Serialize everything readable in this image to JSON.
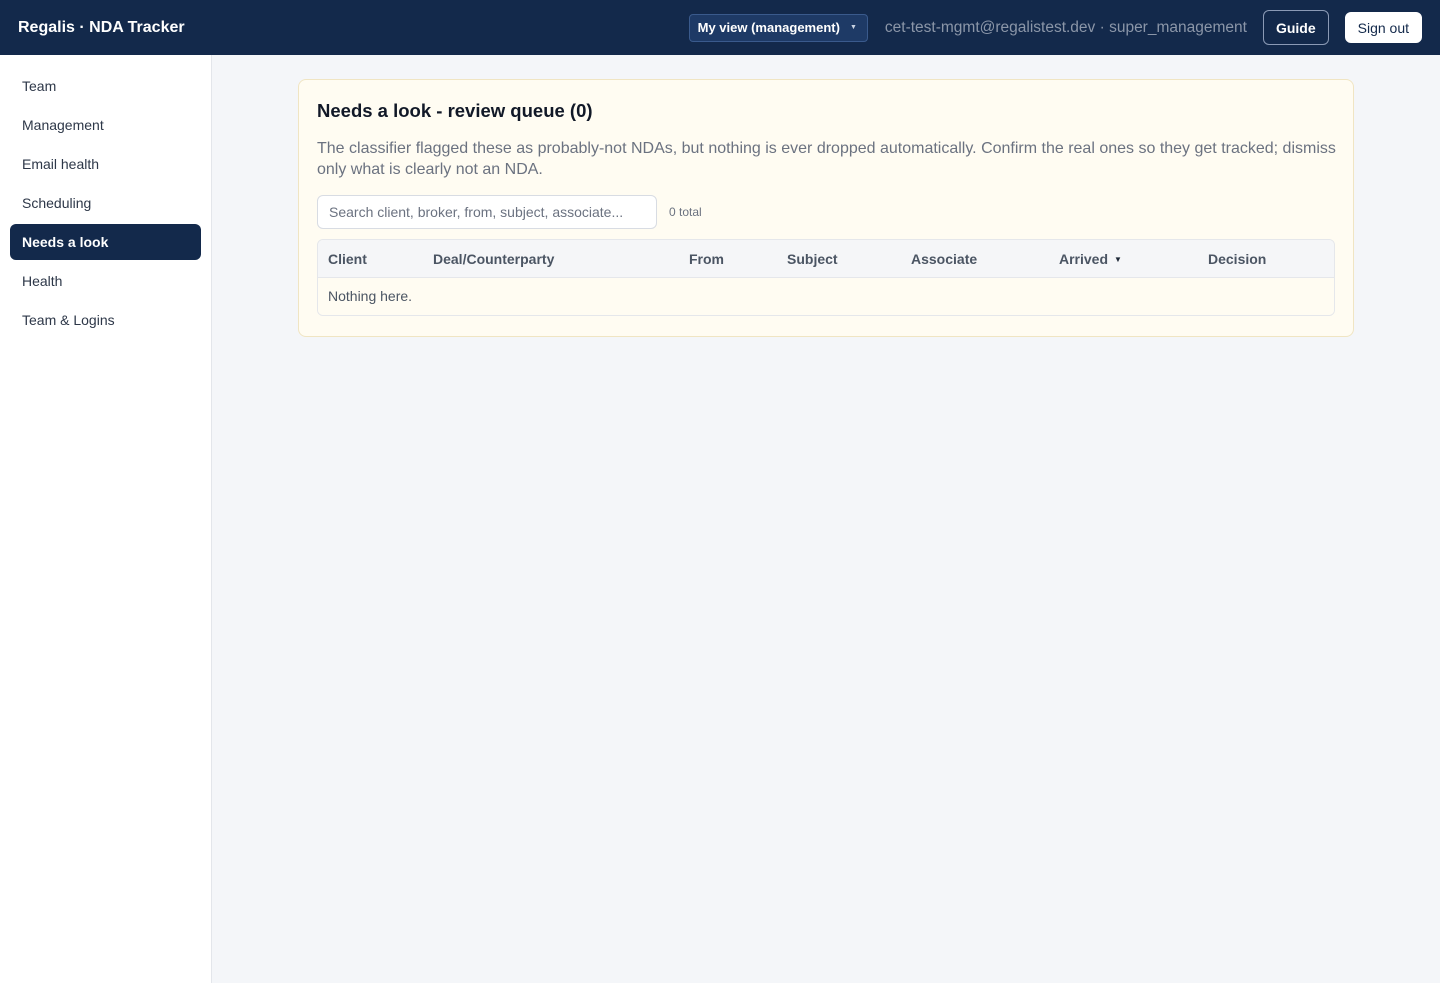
{
  "app": {
    "title": "Regalis · NDA Tracker"
  },
  "header": {
    "view_select": "My view (management)",
    "user_info": "cet-test-mgmt@regalistest.dev · super_management",
    "guide_label": "Guide",
    "signout_label": "Sign out"
  },
  "sidebar": {
    "items": [
      {
        "label": "Team"
      },
      {
        "label": "Management"
      },
      {
        "label": "Email health"
      },
      {
        "label": "Scheduling"
      },
      {
        "label": "Needs a look",
        "active": true
      },
      {
        "label": "Health"
      },
      {
        "label": "Team & Logins"
      }
    ]
  },
  "main": {
    "title": "Needs a look - review queue (0)",
    "description": "The classifier flagged these as probably-not NDAs, but nothing is ever dropped automatically. Confirm the real ones so they get tracked; dismiss only what is clearly not an NDA.",
    "search": {
      "placeholder": "Search client, broker, from, subject, associate...",
      "value": ""
    },
    "total": "0 total",
    "table": {
      "columns": [
        "Client",
        "Deal/Counterparty",
        "From",
        "Subject",
        "Associate",
        "Arrived",
        "Decision"
      ],
      "sorted_column": "Arrived",
      "sort_direction": "descending",
      "empty_message": "Nothing here."
    }
  },
  "colors": {
    "topbar": "#13294b",
    "active_nav": "#13294b",
    "card_background": "#fffcf2",
    "page_background": "#f4f6f9"
  }
}
